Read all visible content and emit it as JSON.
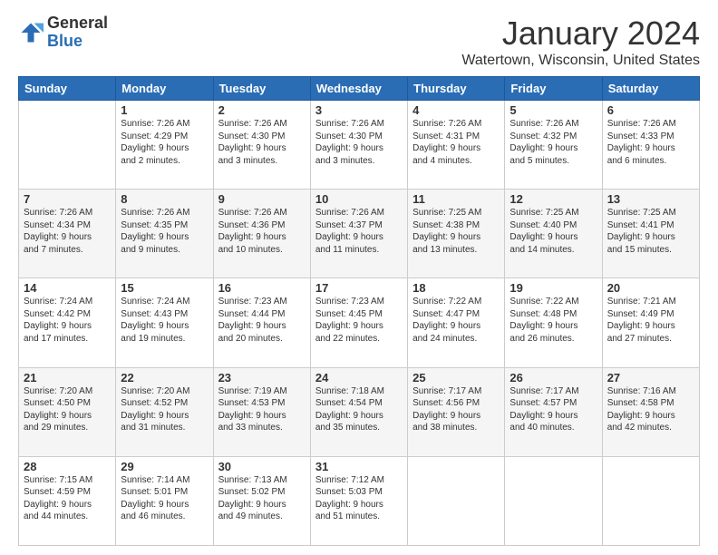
{
  "header": {
    "logo": {
      "general": "General",
      "blue": "Blue"
    },
    "title": "January 2024",
    "location": "Watertown, Wisconsin, United States"
  },
  "weekdays": [
    "Sunday",
    "Monday",
    "Tuesday",
    "Wednesday",
    "Thursday",
    "Friday",
    "Saturday"
  ],
  "weeks": [
    [
      {
        "day": null,
        "info": ""
      },
      {
        "day": "1",
        "info": "Sunrise: 7:26 AM\nSunset: 4:29 PM\nDaylight: 9 hours\nand 2 minutes."
      },
      {
        "day": "2",
        "info": "Sunrise: 7:26 AM\nSunset: 4:30 PM\nDaylight: 9 hours\nand 3 minutes."
      },
      {
        "day": "3",
        "info": "Sunrise: 7:26 AM\nSunset: 4:30 PM\nDaylight: 9 hours\nand 3 minutes."
      },
      {
        "day": "4",
        "info": "Sunrise: 7:26 AM\nSunset: 4:31 PM\nDaylight: 9 hours\nand 4 minutes."
      },
      {
        "day": "5",
        "info": "Sunrise: 7:26 AM\nSunset: 4:32 PM\nDaylight: 9 hours\nand 5 minutes."
      },
      {
        "day": "6",
        "info": "Sunrise: 7:26 AM\nSunset: 4:33 PM\nDaylight: 9 hours\nand 6 minutes."
      }
    ],
    [
      {
        "day": "7",
        "info": "Sunrise: 7:26 AM\nSunset: 4:34 PM\nDaylight: 9 hours\nand 7 minutes."
      },
      {
        "day": "8",
        "info": "Sunrise: 7:26 AM\nSunset: 4:35 PM\nDaylight: 9 hours\nand 9 minutes."
      },
      {
        "day": "9",
        "info": "Sunrise: 7:26 AM\nSunset: 4:36 PM\nDaylight: 9 hours\nand 10 minutes."
      },
      {
        "day": "10",
        "info": "Sunrise: 7:26 AM\nSunset: 4:37 PM\nDaylight: 9 hours\nand 11 minutes."
      },
      {
        "day": "11",
        "info": "Sunrise: 7:25 AM\nSunset: 4:38 PM\nDaylight: 9 hours\nand 13 minutes."
      },
      {
        "day": "12",
        "info": "Sunrise: 7:25 AM\nSunset: 4:40 PM\nDaylight: 9 hours\nand 14 minutes."
      },
      {
        "day": "13",
        "info": "Sunrise: 7:25 AM\nSunset: 4:41 PM\nDaylight: 9 hours\nand 15 minutes."
      }
    ],
    [
      {
        "day": "14",
        "info": "Sunrise: 7:24 AM\nSunset: 4:42 PM\nDaylight: 9 hours\nand 17 minutes."
      },
      {
        "day": "15",
        "info": "Sunrise: 7:24 AM\nSunset: 4:43 PM\nDaylight: 9 hours\nand 19 minutes."
      },
      {
        "day": "16",
        "info": "Sunrise: 7:23 AM\nSunset: 4:44 PM\nDaylight: 9 hours\nand 20 minutes."
      },
      {
        "day": "17",
        "info": "Sunrise: 7:23 AM\nSunset: 4:45 PM\nDaylight: 9 hours\nand 22 minutes."
      },
      {
        "day": "18",
        "info": "Sunrise: 7:22 AM\nSunset: 4:47 PM\nDaylight: 9 hours\nand 24 minutes."
      },
      {
        "day": "19",
        "info": "Sunrise: 7:22 AM\nSunset: 4:48 PM\nDaylight: 9 hours\nand 26 minutes."
      },
      {
        "day": "20",
        "info": "Sunrise: 7:21 AM\nSunset: 4:49 PM\nDaylight: 9 hours\nand 27 minutes."
      }
    ],
    [
      {
        "day": "21",
        "info": "Sunrise: 7:20 AM\nSunset: 4:50 PM\nDaylight: 9 hours\nand 29 minutes."
      },
      {
        "day": "22",
        "info": "Sunrise: 7:20 AM\nSunset: 4:52 PM\nDaylight: 9 hours\nand 31 minutes."
      },
      {
        "day": "23",
        "info": "Sunrise: 7:19 AM\nSunset: 4:53 PM\nDaylight: 9 hours\nand 33 minutes."
      },
      {
        "day": "24",
        "info": "Sunrise: 7:18 AM\nSunset: 4:54 PM\nDaylight: 9 hours\nand 35 minutes."
      },
      {
        "day": "25",
        "info": "Sunrise: 7:17 AM\nSunset: 4:56 PM\nDaylight: 9 hours\nand 38 minutes."
      },
      {
        "day": "26",
        "info": "Sunrise: 7:17 AM\nSunset: 4:57 PM\nDaylight: 9 hours\nand 40 minutes."
      },
      {
        "day": "27",
        "info": "Sunrise: 7:16 AM\nSunset: 4:58 PM\nDaylight: 9 hours\nand 42 minutes."
      }
    ],
    [
      {
        "day": "28",
        "info": "Sunrise: 7:15 AM\nSunset: 4:59 PM\nDaylight: 9 hours\nand 44 minutes."
      },
      {
        "day": "29",
        "info": "Sunrise: 7:14 AM\nSunset: 5:01 PM\nDaylight: 9 hours\nand 46 minutes."
      },
      {
        "day": "30",
        "info": "Sunrise: 7:13 AM\nSunset: 5:02 PM\nDaylight: 9 hours\nand 49 minutes."
      },
      {
        "day": "31",
        "info": "Sunrise: 7:12 AM\nSunset: 5:03 PM\nDaylight: 9 hours\nand 51 minutes."
      },
      {
        "day": null,
        "info": ""
      },
      {
        "day": null,
        "info": ""
      },
      {
        "day": null,
        "info": ""
      }
    ]
  ]
}
